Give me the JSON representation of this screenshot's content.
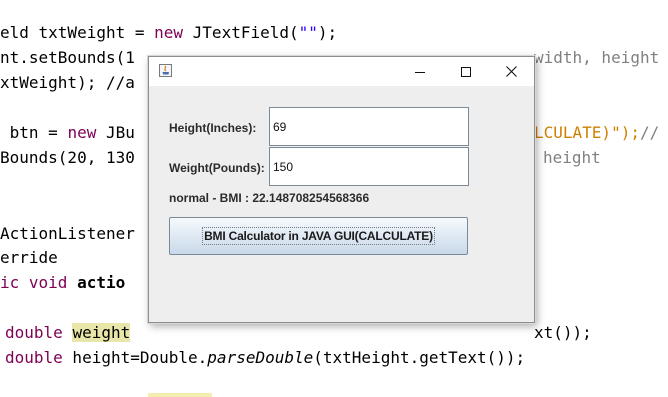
{
  "code_lines": {
    "l1": {
      "a": "eld txtWeight = ",
      "kw": "new",
      "b": " JTextField(",
      "str": "\"\"",
      "c": ");"
    },
    "l2": {
      "a": "nt.setBounds(1",
      "cmt": "// ",
      "b": "width, height"
    },
    "l3": {
      "a": "xtWeight); //a"
    },
    "l4": {
      "a": " btn = ",
      "kw": "new",
      "b": " JBu",
      "org": "LCULATE)\");",
      "c": "//"
    },
    "l5": {
      "a": "Bounds(20, 130",
      "cmt": "height"
    },
    "l6": {
      "a": "ActionListener"
    },
    "l7": {
      "a": "erride"
    },
    "l8": {
      "kw": "ic void",
      "bold": "actio"
    },
    "l9": {
      "kw": "double",
      "hl": "weight",
      "b": "xt());"
    },
    "l10": {
      "kw": "double",
      "a": " height=Double.",
      "ital": "parseDouble",
      "b": "(txtHeight.getText());"
    }
  },
  "window": {
    "title": "",
    "app_icon": "java-icon",
    "minimize_glyph": "—",
    "maximize_glyph": "☐",
    "close_glyph": "✕"
  },
  "form": {
    "height_label": "Height(Inches):",
    "height_value": "69",
    "weight_label": "Weight(Pounds):",
    "weight_value": "150",
    "result_text": "normal - BMI : 22.148708254568366",
    "calc_button_label": "BMI Calculator in JAVA GUI(CALCULATE)"
  }
}
